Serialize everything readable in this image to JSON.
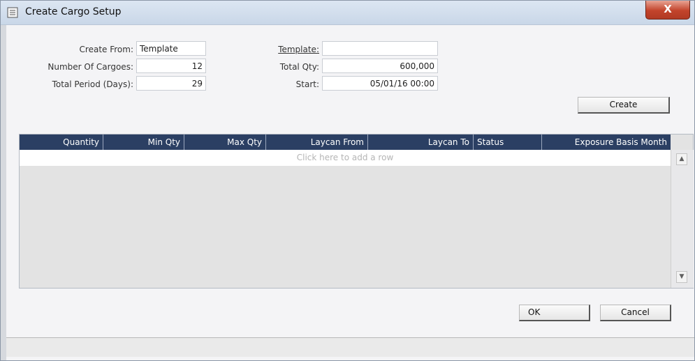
{
  "window": {
    "title": "Create Cargo Setup",
    "close_label": "X"
  },
  "form": {
    "create_from": {
      "label": "Create From:",
      "value": "Template"
    },
    "number_of_cargoes": {
      "label": "Number Of Cargoes:",
      "value": "12"
    },
    "total_period": {
      "label": "Total Period (Days):",
      "value": "29"
    },
    "template": {
      "label": "Template:",
      "value": ""
    },
    "total_qty": {
      "label": "Total Qty:",
      "value": "600,000"
    },
    "start": {
      "label": "Start:",
      "value": "05/01/16 00:00"
    }
  },
  "buttons": {
    "create": "Create",
    "ok": "OK",
    "cancel": "Cancel"
  },
  "grid": {
    "columns": [
      "Quantity",
      "Min Qty",
      "Max Qty",
      "Laycan From",
      "Laycan To",
      "Status",
      "Exposure Basis Month"
    ],
    "add_row_text": "Click here to add a row",
    "rows": []
  },
  "icons": {
    "title": "window-icon",
    "scroll_up": "arrow-up-icon",
    "scroll_down": "arrow-down-icon"
  }
}
